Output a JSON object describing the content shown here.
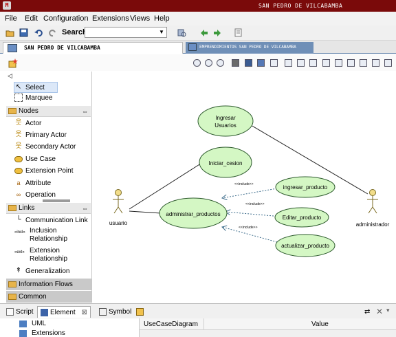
{
  "window": {
    "title": "SAN PEDRO DE VILCABAMBA"
  },
  "menu": [
    "File",
    "Edit",
    "Configuration",
    "Extensions",
    "Views",
    "Help"
  ],
  "toolbar": {
    "search_label": "Search:",
    "search_value": ""
  },
  "tabs": [
    {
      "label": "SAN PEDRO DE VILCABAMBA",
      "active": true
    },
    {
      "label": "EMPRENDIMIENTOS SAN PEDRO DE VILCABAMBA",
      "active": false
    }
  ],
  "palette": {
    "collapse_glyph": "◁",
    "tools": [
      {
        "label": "Select",
        "icon": "select-arrow-icon",
        "selected": true
      },
      {
        "label": "Marquee",
        "icon": "marquee-icon",
        "selected": false
      }
    ],
    "nodes_header": "Nodes",
    "nodes": [
      {
        "label": "Actor",
        "icon": "actor-icon"
      },
      {
        "label": "Primary Actor",
        "icon": "primary-actor-icon"
      },
      {
        "label": "Secondary Actor",
        "icon": "secondary-actor-icon"
      },
      {
        "label": "Use Case",
        "icon": "use-case-icon"
      },
      {
        "label": "Extension Point",
        "icon": "extension-point-icon"
      },
      {
        "label": "Attribute",
        "icon": "attribute-icon"
      },
      {
        "label": "Operation",
        "icon": "operation-icon"
      }
    ],
    "links_header": "Links",
    "links": [
      {
        "label": "Communication Link",
        "icon": "communication-link-icon"
      },
      {
        "label": "Inclusion",
        "label2": "Relationship",
        "icon": "inclusion-icon",
        "icon_text": "«incl»"
      },
      {
        "label": "Extension",
        "label2": "Relationship",
        "icon": "extension-icon",
        "icon_text": "«ext»"
      },
      {
        "label": "Generalization",
        "icon": "generalization-icon"
      }
    ],
    "drawers": [
      "Information Flows",
      "Common"
    ]
  },
  "diagram": {
    "actors": [
      {
        "id": "usuario",
        "label": "usuario"
      },
      {
        "id": "administrador",
        "label": "administrador"
      }
    ],
    "use_cases": [
      {
        "id": "ingresar_usuarios",
        "line1": "Ingresar",
        "line2": "Usuarios"
      },
      {
        "id": "iniciar_cesion",
        "line1": "Iniciar_cesion",
        "line2": ""
      },
      {
        "id": "administrar_productos",
        "line1": "administrar_productos",
        "line2": ""
      },
      {
        "id": "ingresar_producto",
        "line1": "ingresar_producto",
        "line2": ""
      },
      {
        "id": "editar_producto",
        "line1": "Editar_producto",
        "line2": ""
      },
      {
        "id": "actualizar_producto",
        "line1": "actualizar_producto",
        "line2": ""
      }
    ],
    "include_label": "<<include>>"
  },
  "bottom": {
    "tabs": [
      {
        "label": "Script",
        "icon": "script-icon"
      },
      {
        "label": "Element",
        "icon": "element-icon",
        "active": true,
        "close": "⊠"
      },
      {
        "label": "Symbol",
        "icon": "symbol-icon"
      }
    ],
    "tree": [
      "UML",
      "Extensions"
    ],
    "property_columns": [
      "UseCaseDiagram",
      "Value"
    ]
  },
  "colors": {
    "title_bar": "#7a0a0a",
    "use_case_fill": "#d4f7c4",
    "use_case_stroke": "#2d5a2d",
    "actor_head": "#f2dd8a",
    "tab_inactive": "#6f8fb7"
  }
}
